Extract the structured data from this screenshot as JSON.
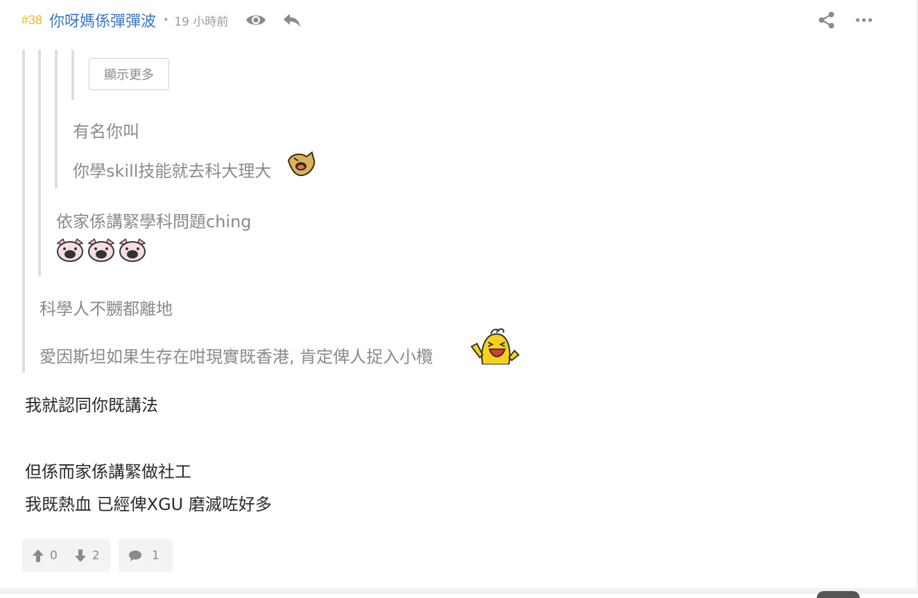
{
  "post": {
    "number": "#38",
    "author": "你呀媽係彈彈波",
    "bullet": "•",
    "time": "19 小時前"
  },
  "quotes": {
    "show_more": "顯示更多",
    "level3": [
      "有名你叫",
      "你學skill技能就去科大理大"
    ],
    "level2": [
      "依家係講緊學科問題ching"
    ],
    "level1": [
      "科學人不嬲都離地",
      "愛因斯坦如果生存在咁現實既香港, 肯定俾人捉入小欖"
    ]
  },
  "reply": {
    "line1": "我就認同你既講法",
    "line2": "但係而家係講緊做社工",
    "line3": "我既熱血 已經俾XGU 磨滅咗好多"
  },
  "footer": {
    "upvotes": "0",
    "downvotes": "2",
    "replies": "1"
  },
  "colors": {
    "post_number": "#f0b429",
    "author": "#3b78c2",
    "quote_text": "#8a8a8a",
    "body_text": "#2a2a2a"
  },
  "icons": [
    "eye-icon",
    "reply-icon",
    "share-icon",
    "more-icon",
    "thumbs-up-icon",
    "thumbs-down-icon",
    "comment-icon"
  ]
}
